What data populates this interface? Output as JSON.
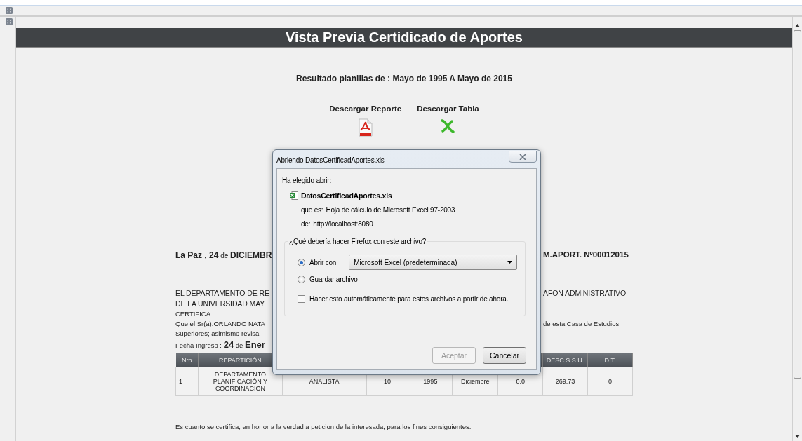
{
  "page": {
    "title": "Vista Previa Certidicado de Aportes",
    "subtitle": "Resultado planillas de : Mayo de 1995 A Mayo de 2015",
    "downloads": [
      {
        "label": "Descargar Reporte",
        "kind": "pdf"
      },
      {
        "label": "Descargar Tabla",
        "kind": "xls"
      }
    ],
    "lines": [
      {
        "kind": "heading",
        "left": "**La Paz , 24** de **DICIEMBR**",
        "right": "M.APORT. Nº00012015"
      },
      {
        "kind": "body",
        "left": "EL DEPARTAMENTO DE RE",
        "right": "AFON ADMINISTRATIVO"
      },
      {
        "kind": "body",
        "left": "DE LA UNIVERSIDAD MAY"
      },
      {
        "kind": "small",
        "left": "CERTIFICA:"
      },
      {
        "kind": "small",
        "left": "Que el Sr(a).ORLANDO NATA",
        "right": "de esta Casa de Estudios"
      },
      {
        "kind": "small",
        "left": "Superiores; asimismo revisa"
      },
      {
        "kind": "date",
        "left": "Fecha Ingreso : **24** de **Ener**"
      }
    ],
    "table": {
      "header_left": [
        "Nro",
        "REPARTICIÓN"
      ],
      "header_right": [
        "DESC.S.S.U.",
        "D.T."
      ],
      "rows": [
        [
          "1",
          "DEPARTAMENTO PLANIFICACIÓN Y COORDINACION",
          "ANALISTA",
          "10",
          "1995",
          "Diciembre",
          "0.0",
          "269.73",
          "0"
        ]
      ]
    },
    "footer": "Es cuanto se certifica, en honor a la verdad a peticion de la interesada, para los fines consiguientes."
  },
  "dialog": {
    "title": "Abriendo DatosCertificadAportes.xls",
    "intro": "Ha elegido abrir:",
    "file": "DatosCertificadAportes.xls",
    "type_label": "que es:",
    "type": "Hoja de cálculo de Microsoft Excel 97-2003",
    "from_label": "de:",
    "from": "http://localhost:8080",
    "question": "¿Qué debería hacer Firefox con este archivo?",
    "options": [
      {
        "kind": "radio",
        "label": "Abrir con",
        "selected": true,
        "app": "Microsoft Excel (predeterminada)"
      },
      {
        "kind": "radio",
        "label": "Guardar archivo",
        "selected": false
      },
      {
        "kind": "checkbox",
        "label": "Hacer esto automáticamente para estos archivos a partir de ahora.",
        "checked": false
      }
    ],
    "buttons": [
      {
        "label": "Aceptar",
        "disabled": true
      },
      {
        "label": "Cancelar",
        "disabled": false
      }
    ]
  }
}
